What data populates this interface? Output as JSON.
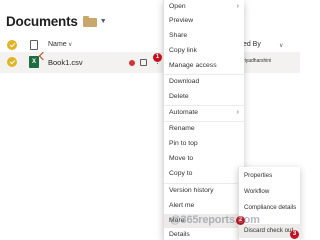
{
  "header": {
    "title": "Documents",
    "library_icon": "library-icon"
  },
  "columns": {
    "name": "Name",
    "modified_by": "dified By"
  },
  "file": {
    "name": "Book1.csv",
    "modified_by": "a priyadharshini"
  },
  "context_menu": {
    "items": [
      {
        "label": "Open",
        "has_submenu": true
      },
      {
        "label": "Preview"
      },
      {
        "label": "Share"
      },
      {
        "label": "Copy link"
      },
      {
        "label": "Manage access"
      },
      {
        "label": "Download"
      },
      {
        "label": "Delete"
      },
      {
        "label": "Automate",
        "has_submenu": true
      },
      {
        "label": "Rename"
      },
      {
        "label": "Pin to top"
      },
      {
        "label": "Move to"
      },
      {
        "label": "Copy to"
      },
      {
        "label": "Version history"
      },
      {
        "label": "Alert me"
      },
      {
        "label": "More",
        "has_submenu": true
      },
      {
        "label": "Details"
      }
    ]
  },
  "submenu": {
    "items": [
      {
        "label": "Properties"
      },
      {
        "label": "Workflow"
      },
      {
        "label": "Compliance details"
      },
      {
        "label": "Discard check out"
      }
    ]
  },
  "badges": [
    "1",
    "2",
    "3"
  ],
  "watermark": "@365reports.com",
  "colors": {
    "accent": "#e0b423",
    "badge": "#c50f1f",
    "excel": "#1d6f42",
    "highlight": "#edebe9"
  }
}
